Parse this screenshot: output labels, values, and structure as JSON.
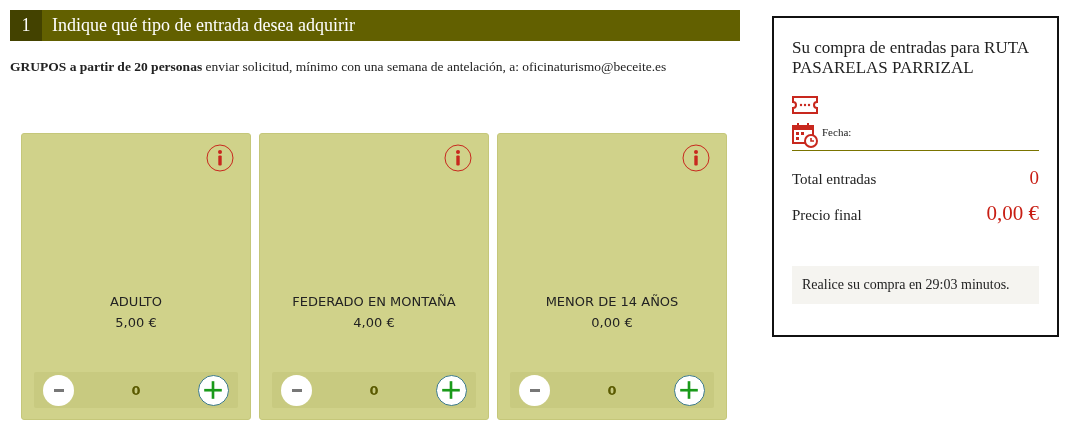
{
  "step": {
    "number": "1",
    "title": "Indique qué tipo de entrada desea adquirir"
  },
  "note": "**GRUPOS a partir de 20 personas** enviar solicitud, mínimo con una semana de antelación, a: oficinaturismo@beceite.es",
  "tickets": [
    {
      "name": "ADULTO",
      "price": "5,00 €",
      "quantity": "0"
    },
    {
      "name": "FEDERADO EN MONTAÑA",
      "price": "4,00 €",
      "quantity": "0"
    },
    {
      "name": "MENOR DE 14 AÑOS",
      "price": "0,00 €",
      "quantity": "0"
    }
  ],
  "summary": {
    "title": "Su compra de entradas para RUTA PASARELAS PARRIZAL",
    "date_label": "Fecha:",
    "total_label": "Total entradas",
    "total_value": "0",
    "price_label": "Precio final",
    "price_value": "0,00 €",
    "timer": "Realice su compra en 29:03 minutos."
  }
}
